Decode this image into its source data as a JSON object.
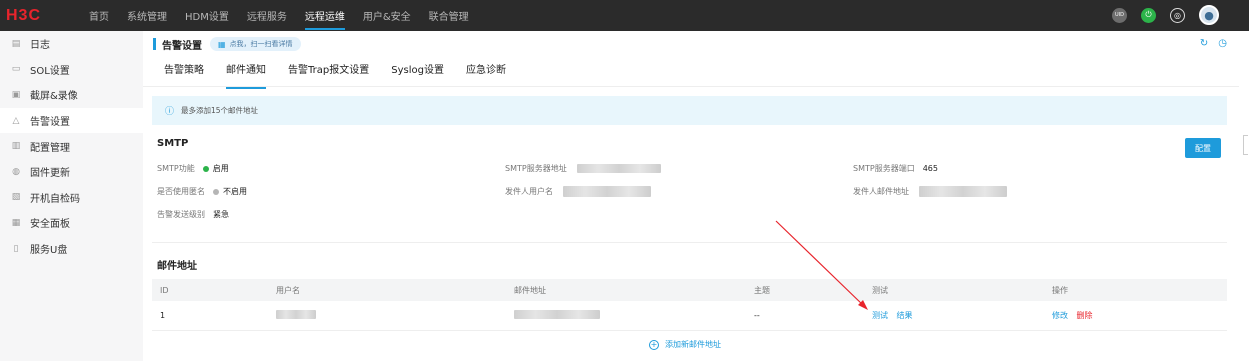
{
  "brand": {
    "logo_text": "H3C",
    "accent": "#1e9bdb",
    "danger": "#e8242c"
  },
  "topnav": {
    "items": [
      {
        "label": "首页",
        "active": false
      },
      {
        "label": "系统管理",
        "active": false
      },
      {
        "label": "HDM设置",
        "active": false
      },
      {
        "label": "远程服务",
        "active": false
      },
      {
        "label": "远程运维",
        "active": true
      },
      {
        "label": "用户&安全",
        "active": false
      },
      {
        "label": "联合管理",
        "active": false
      }
    ],
    "icons": {
      "uid": "UID",
      "uid_icon": "uid-icon",
      "power_icon": "power-icon",
      "globe_icon": "globe-icon",
      "avatar_icon": "avatar-icon"
    }
  },
  "sidebar": {
    "items": [
      {
        "label": "日志",
        "icon": "log-icon"
      },
      {
        "label": "SOL设置",
        "icon": "sol-icon"
      },
      {
        "label": "截屏&录像",
        "icon": "screenshot-icon"
      },
      {
        "label": "告警设置",
        "icon": "alarm-icon",
        "active": true
      },
      {
        "label": "配置管理",
        "icon": "config-icon"
      },
      {
        "label": "固件更新",
        "icon": "firmware-icon"
      },
      {
        "label": "开机自检码",
        "icon": "post-code-icon"
      },
      {
        "label": "安全面板",
        "icon": "panel-icon"
      },
      {
        "label": "服务U盘",
        "icon": "usb-icon"
      }
    ]
  },
  "page": {
    "title": "告警设置",
    "hint": "点我，扫一扫看详情",
    "tabs": [
      "告警策略",
      "邮件通知",
      "告警Trap报文设置",
      "Syslog设置",
      "应急诊断"
    ],
    "active_tab": "邮件通知",
    "notice": "最多添加15个邮件地址"
  },
  "smtp": {
    "section_title": "SMTP",
    "config_button": "配置",
    "fields": {
      "smtp_enable_label": "SMTP功能",
      "smtp_enable_value": "启用",
      "smtp_enable_color": "#2cb34a",
      "anonymous_label": "是否使用匿名",
      "anonymous_value": "不启用",
      "anonymous_color": "#b5b5b5",
      "level_label": "告警发送级别",
      "level_value": "紧急",
      "server_addr_label": "SMTP服务器地址",
      "sender_user_label": "发件人用户名",
      "server_port_label": "SMTP服务器端口",
      "server_port_value": "465",
      "sender_mail_label": "发件人邮件地址"
    }
  },
  "mail": {
    "section_title": "邮件地址",
    "columns": [
      "ID",
      "用户名",
      "邮件地址",
      "主题",
      "测试",
      "操作"
    ],
    "rows": [
      {
        "id": "1",
        "subject": "--",
        "test_label": "测试",
        "result_label": "结果",
        "edit_label": "修改",
        "delete_label": "删除"
      }
    ],
    "add_label": "添加新邮件地址"
  }
}
